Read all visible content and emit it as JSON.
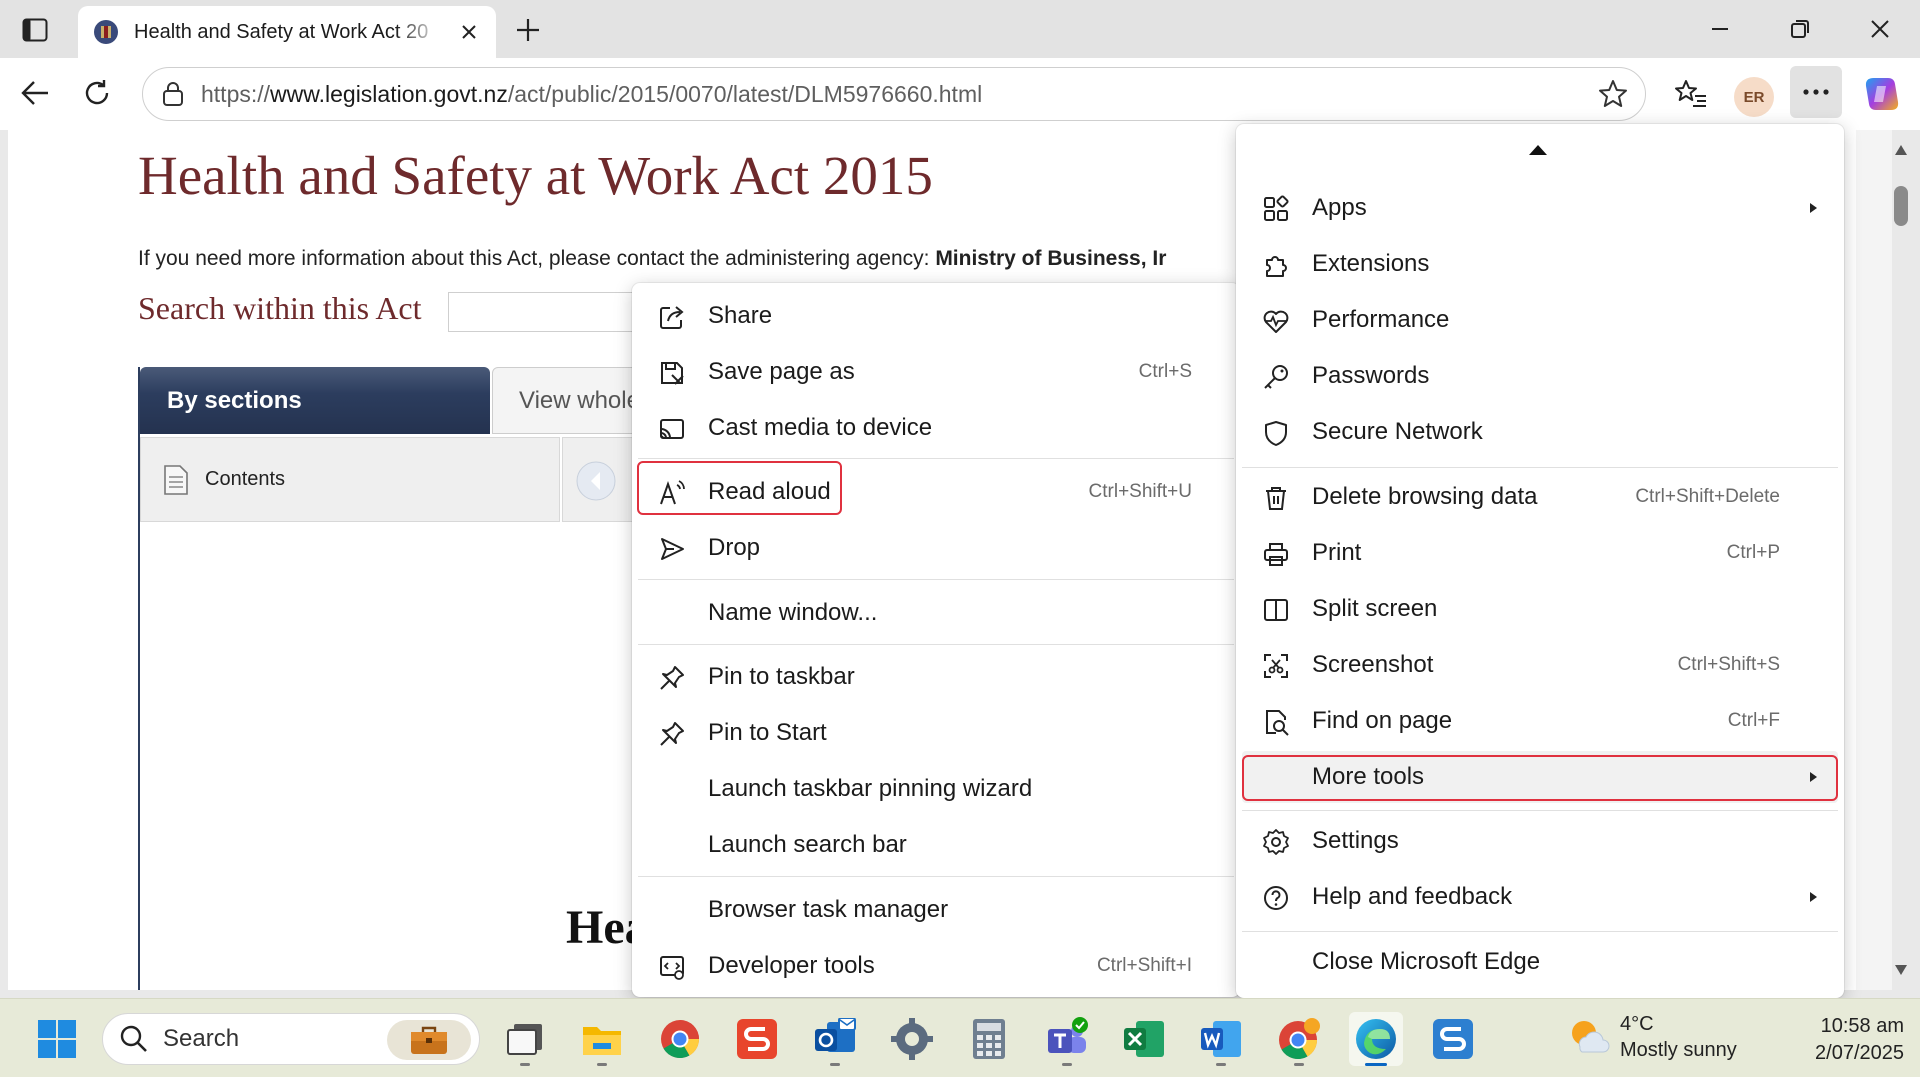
{
  "browser": {
    "tab": {
      "title": "Health and Safety at Work Act 20"
    },
    "address": {
      "url_prefix": "https://",
      "url_host": "www.legislation.govt.nz",
      "url_path": "/act/public/2015/0070/latest/DLM5976660.html"
    },
    "profile_initials": "ER"
  },
  "page": {
    "title": "Health and Safety at Work Act 2015",
    "info_text": "If you need more information about this Act, please contact the administering agency:",
    "info_agency": "Ministry of Business, Ir",
    "search_label": "Search within this Act",
    "tab_by_sections": "By sections",
    "tab_view_whole": "View whole",
    "contents_label": "Contents",
    "bottom_heading": "Hea"
  },
  "main_menu": {
    "items": [
      {
        "label": "Apps",
        "shortcut": "",
        "has_submenu": true,
        "icon": "apps-icon"
      },
      {
        "label": "Extensions",
        "shortcut": "",
        "has_submenu": false,
        "icon": "extensions-icon"
      },
      {
        "label": "Performance",
        "shortcut": "",
        "has_submenu": false,
        "icon": "performance-icon"
      },
      {
        "label": "Passwords",
        "shortcut": "",
        "has_submenu": false,
        "icon": "key-icon"
      },
      {
        "label": "Secure Network",
        "shortcut": "",
        "has_submenu": false,
        "icon": "shield-icon"
      },
      {
        "label": "Delete browsing data",
        "shortcut": "Ctrl+Shift+Delete",
        "has_submenu": false,
        "icon": "trash-icon"
      },
      {
        "label": "Print",
        "shortcut": "Ctrl+P",
        "has_submenu": false,
        "icon": "printer-icon"
      },
      {
        "label": "Split screen",
        "shortcut": "",
        "has_submenu": false,
        "icon": "split-screen-icon"
      },
      {
        "label": "Screenshot",
        "shortcut": "Ctrl+Shift+S",
        "has_submenu": false,
        "icon": "screenshot-icon"
      },
      {
        "label": "Find on page",
        "shortcut": "Ctrl+F",
        "has_submenu": false,
        "icon": "find-icon"
      },
      {
        "label": "More tools",
        "shortcut": "",
        "has_submenu": true,
        "icon": ""
      },
      {
        "label": "Settings",
        "shortcut": "",
        "has_submenu": false,
        "icon": "gear-icon"
      },
      {
        "label": "Help and feedback",
        "shortcut": "",
        "has_submenu": true,
        "icon": "help-icon"
      },
      {
        "label": "Close Microsoft Edge",
        "shortcut": "",
        "has_submenu": false,
        "icon": ""
      }
    ]
  },
  "more_tools_menu": {
    "items": [
      {
        "label": "Share",
        "shortcut": "",
        "icon": "share-icon"
      },
      {
        "label": "Save page as",
        "shortcut": "Ctrl+S",
        "icon": "save-icon"
      },
      {
        "label": "Cast media to device",
        "shortcut": "",
        "icon": "cast-icon"
      },
      {
        "label": "Read aloud",
        "shortcut": "Ctrl+Shift+U",
        "icon": "read-aloud-icon"
      },
      {
        "label": "Drop",
        "shortcut": "",
        "icon": "send-icon"
      },
      {
        "label": "Name window...",
        "shortcut": "",
        "icon": ""
      },
      {
        "label": "Pin to taskbar",
        "shortcut": "",
        "icon": "pin-icon"
      },
      {
        "label": "Pin to Start",
        "shortcut": "",
        "icon": "pin-icon"
      },
      {
        "label": "Launch taskbar pinning wizard",
        "shortcut": "",
        "icon": ""
      },
      {
        "label": "Launch search bar",
        "shortcut": "",
        "icon": ""
      },
      {
        "label": "Browser task manager",
        "shortcut": "",
        "icon": ""
      },
      {
        "label": "Developer tools",
        "shortcut": "Ctrl+Shift+I",
        "icon": "developer-tools-icon"
      }
    ]
  },
  "highlight_color": "#e0313f",
  "taskbar": {
    "search_placeholder": "Search",
    "weather_temp": "4°C",
    "weather_condition": "Mostly sunny",
    "time": "10:58 am",
    "date": "2/07/2025"
  }
}
